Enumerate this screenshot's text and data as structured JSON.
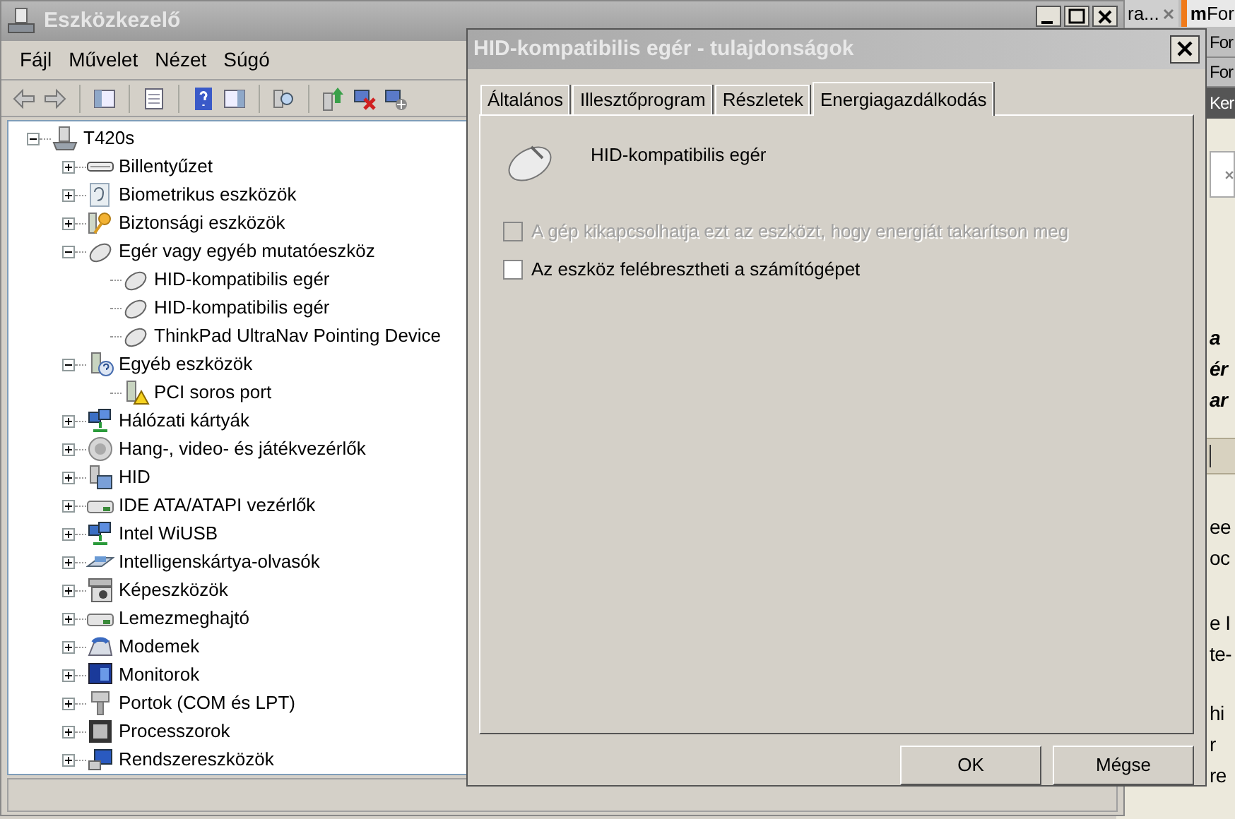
{
  "device_manager": {
    "title": "Eszközkezelő",
    "menu": [
      "Fájl",
      "Művelet",
      "Nézet",
      "Súgó"
    ],
    "tree": [
      {
        "label": "T420s",
        "expanded": true,
        "children": [
          {
            "label": "Billentyűzet",
            "expanded": false
          },
          {
            "label": "Biometrikus eszközök",
            "expanded": false
          },
          {
            "label": "Biztonsági eszközök",
            "expanded": false
          },
          {
            "label": "Egér vagy egyéb mutatóeszköz",
            "expanded": true,
            "children": [
              {
                "label": "HID-kompatibilis egér"
              },
              {
                "label": "HID-kompatibilis egér"
              },
              {
                "label": "ThinkPad UltraNav Pointing Device"
              }
            ]
          },
          {
            "label": "Egyéb eszközök",
            "expanded": true,
            "children": [
              {
                "label": "PCI soros port"
              }
            ]
          },
          {
            "label": "Hálózati kártyák",
            "expanded": false
          },
          {
            "label": "Hang-, video- és játékvezérlők",
            "expanded": false
          },
          {
            "label": "HID",
            "expanded": false
          },
          {
            "label": "IDE ATA/ATAPI vezérlők",
            "expanded": false
          },
          {
            "label": "Intel WiUSB",
            "expanded": false
          },
          {
            "label": "Intelligenskártya-olvasók",
            "expanded": false
          },
          {
            "label": "Képeszközök",
            "expanded": false
          },
          {
            "label": "Lemezmeghajtó",
            "expanded": false
          },
          {
            "label": "Modemek",
            "expanded": false
          },
          {
            "label": "Monitorok",
            "expanded": false
          },
          {
            "label": "Portok (COM és LPT)",
            "expanded": false
          },
          {
            "label": "Processzorok",
            "expanded": false
          },
          {
            "label": "Rendszereszközök",
            "expanded": false
          }
        ]
      }
    ]
  },
  "dialog": {
    "title": "HID-kompatibilis egér - tulajdonságok",
    "tabs": [
      {
        "label": "Általános",
        "selected": false
      },
      {
        "label": "Illesztőprogram",
        "selected": false
      },
      {
        "label": "Részletek",
        "selected": false
      },
      {
        "label": "Energiagazdálkodás",
        "selected": true
      }
    ],
    "device_name": "HID-kompatibilis egér",
    "options": [
      {
        "label": "A gép kikapcsolhatja ezt az eszközt, hogy energiát takarítson meg",
        "checked": false,
        "disabled": true
      },
      {
        "label": "Az eszköz felébresztheti a számítógépet",
        "checked": false,
        "disabled": false
      }
    ],
    "buttons": [
      "OK",
      "Mégse"
    ]
  },
  "browser": {
    "tabs": [
      {
        "label": "ra...",
        "selected": false
      },
      {
        "label": "**m**For",
        "selected": true
      }
    ],
    "bookmarks": [
      "For",
      "For"
    ],
    "header": "Ker",
    "paragraphs": [
      {
        "kind": "emphasis",
        "lines": [
          "a",
          "ér",
          "ar"
        ]
      },
      {
        "kind": "plain",
        "lines": [
          "ee",
          "oc"
        ]
      },
      {
        "kind": "plain",
        "lines": [
          "e I",
          "te-"
        ]
      },
      {
        "kind": "plain",
        "lines": [
          "hi",
          "r",
          "re"
        ]
      }
    ]
  }
}
